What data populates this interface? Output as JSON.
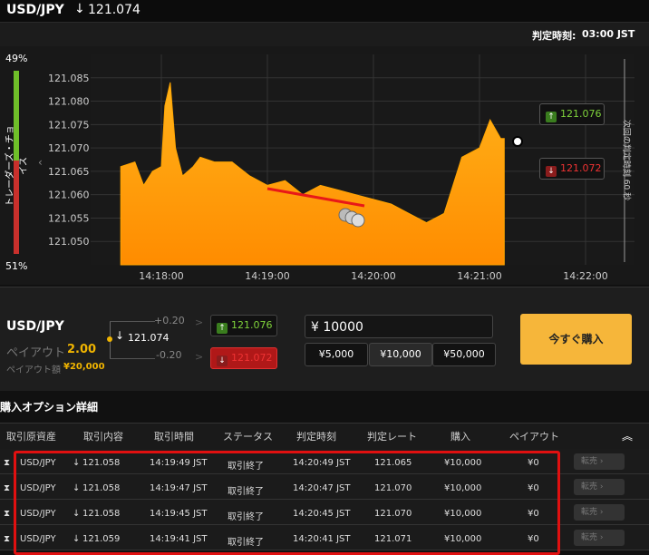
{
  "header": {
    "pair": "USD/JPY",
    "direction_arrow": "↓",
    "rate": "121.074"
  },
  "subheader": {
    "expiry_label": "判定時刻:",
    "expiry_time": "03:00 JST"
  },
  "trader_choice": {
    "label": "トレーダーズ・チョイス",
    "up_pct": "49%",
    "down_pct": "51%",
    "up_fraction": 0.49
  },
  "chart_data": {
    "type": "area",
    "y_ticks": [
      "121.085",
      "121.080",
      "121.075",
      "121.070",
      "121.065",
      "121.060",
      "121.055",
      "121.050"
    ],
    "x_ticks": [
      "14:18:00",
      "14:19:00",
      "14:20:00",
      "14:21:00",
      "14:22:00"
    ],
    "ylim": [
      121.045,
      121.09
    ],
    "x": [
      "14:17:37",
      "14:17:45",
      "14:17:50",
      "14:17:55",
      "14:18:00",
      "14:18:02",
      "14:18:05",
      "14:18:08",
      "14:18:12",
      "14:18:18",
      "14:18:22",
      "14:18:30",
      "14:18:40",
      "14:18:50",
      "14:19:00",
      "14:19:10",
      "14:19:20",
      "14:19:30",
      "14:19:40",
      "14:19:50",
      "14:20:00",
      "14:20:10",
      "14:20:20",
      "14:20:30",
      "14:20:40",
      "14:20:50",
      "14:21:00",
      "14:21:06",
      "14:21:12",
      "14:21:14"
    ],
    "values": [
      121.066,
      121.067,
      121.062,
      121.065,
      121.066,
      121.079,
      121.084,
      121.07,
      121.064,
      121.066,
      121.068,
      121.067,
      121.067,
      121.064,
      121.062,
      121.063,
      121.06,
      121.062,
      121.061,
      121.06,
      121.059,
      121.058,
      121.056,
      121.054,
      121.056,
      121.068,
      121.07,
      121.076,
      121.072,
      121.072
    ],
    "grid": true,
    "next_expiry_label": "次回の判定時刻",
    "next_expiry_seconds": "60 秒",
    "call_rate": "121.076",
    "put_rate": "121.072"
  },
  "trade_panel": {
    "pair": "USD/JPY",
    "payout_label": "ペイアウト",
    "payout_value": "2.00",
    "payout_amount_label": "ペイアウト額",
    "payout_amount_value": "¥20,000",
    "spot_arrow": "↓",
    "spot_rate": "121.074",
    "delta_up": "+0.20",
    "delta_down": "-0.20",
    "gt": ">",
    "call_rate": "121.076",
    "put_rate": "121.072",
    "amount": "¥ 10000",
    "amounts": [
      "¥5,000",
      "¥10,000",
      "¥50,000"
    ],
    "buy_now": "今すぐ購入"
  },
  "details": {
    "title": "購入オプション詳細",
    "columns": [
      "取引原資産",
      "取引内容",
      "取引時間",
      "ステータス",
      "判定時刻",
      "判定レート",
      "購入",
      "ペイアウト"
    ],
    "resell_label": "転売",
    "rows": [
      {
        "asset": "USD/JPY",
        "content": "121.058",
        "time": "14:19:49 JST",
        "status": "取引終了",
        "expiry": "14:20:49 JST",
        "rate": "121.065",
        "purchase": "¥10,000",
        "payout": "¥0"
      },
      {
        "asset": "USD/JPY",
        "content": "121.058",
        "time": "14:19:47 JST",
        "status": "取引終了",
        "expiry": "14:20:47 JST",
        "rate": "121.070",
        "purchase": "¥10,000",
        "payout": "¥0"
      },
      {
        "asset": "USD/JPY",
        "content": "121.058",
        "time": "14:19:45 JST",
        "status": "取引終了",
        "expiry": "14:20:45 JST",
        "rate": "121.070",
        "purchase": "¥10,000",
        "payout": "¥0"
      },
      {
        "asset": "USD/JPY",
        "content": "121.059",
        "time": "14:19:41 JST",
        "status": "取引終了",
        "expiry": "14:20:41 JST",
        "rate": "121.071",
        "purchase": "¥10,000",
        "payout": "¥0"
      }
    ]
  }
}
